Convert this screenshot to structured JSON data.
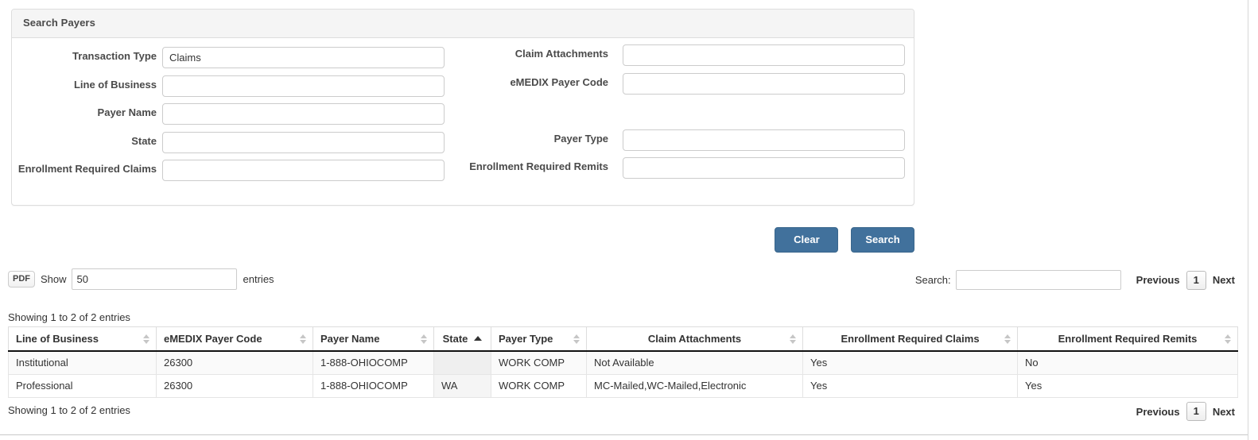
{
  "panel": {
    "title": "Search Payers",
    "fields_left": [
      {
        "label": "Transaction Type",
        "value": "Claims",
        "placeholder": ""
      },
      {
        "label": "Line of Business",
        "value": "",
        "placeholder": ""
      },
      {
        "label": "Payer Name",
        "value": "",
        "placeholder": ""
      },
      {
        "label": "State",
        "value": "",
        "placeholder": ""
      },
      {
        "label": "Enrollment Required Claims",
        "value": "",
        "placeholder": ""
      }
    ],
    "fields_right": [
      {
        "label": "Claim Attachments",
        "value": "",
        "placeholder": ""
      },
      {
        "label": "eMEDIX Payer Code",
        "value": "",
        "placeholder": ""
      },
      {
        "label": "Payer Type",
        "value": "",
        "placeholder": ""
      },
      {
        "label": "Enrollment Required Remits",
        "value": "",
        "placeholder": ""
      }
    ]
  },
  "buttons": {
    "clear": "Clear",
    "search": "Search",
    "accent_color": "#41719c"
  },
  "datatable": {
    "export_pdf": "PDF",
    "show_label": "Show",
    "length_value": "50",
    "entries_label": "entries",
    "filter_label": "Search:",
    "filter_value": "",
    "filter_placeholder": "",
    "info_top": "Showing 1 to 2 of 2 entries",
    "info_bottom": "Showing 1 to 2 of 2 entries",
    "paginate": {
      "previous": "Previous",
      "page": "1",
      "next": "Next"
    },
    "columns": [
      {
        "label": "Line of Business",
        "sort": "none",
        "align": "left"
      },
      {
        "label": "eMEDIX Payer Code",
        "sort": "none",
        "align": "left"
      },
      {
        "label": "Payer Name",
        "sort": "none",
        "align": "left"
      },
      {
        "label": "State",
        "sort": "asc",
        "align": "center"
      },
      {
        "label": "Payer Type",
        "sort": "none",
        "align": "left"
      },
      {
        "label": "Claim Attachments",
        "sort": "none",
        "align": "center"
      },
      {
        "label": "Enrollment Required Claims",
        "sort": "none",
        "align": "center"
      },
      {
        "label": "Enrollment Required Remits",
        "sort": "none",
        "align": "center"
      }
    ],
    "rows": [
      {
        "line_of_business": "Institutional",
        "emedix_payer_code": "26300",
        "payer_name": "1-888-OHIOCOMP",
        "state": "",
        "payer_type": "WORK COMP",
        "claim_attachments": "Not Available",
        "enrollment_required_claims": "Yes",
        "enrollment_required_remits": "No"
      },
      {
        "line_of_business": "Professional",
        "emedix_payer_code": "26300",
        "payer_name": "1-888-OHIOCOMP",
        "state": "WA",
        "payer_type": "WORK COMP",
        "claim_attachments": "MC-Mailed,WC-Mailed,Electronic",
        "enrollment_required_claims": "Yes",
        "enrollment_required_remits": "Yes"
      }
    ]
  }
}
